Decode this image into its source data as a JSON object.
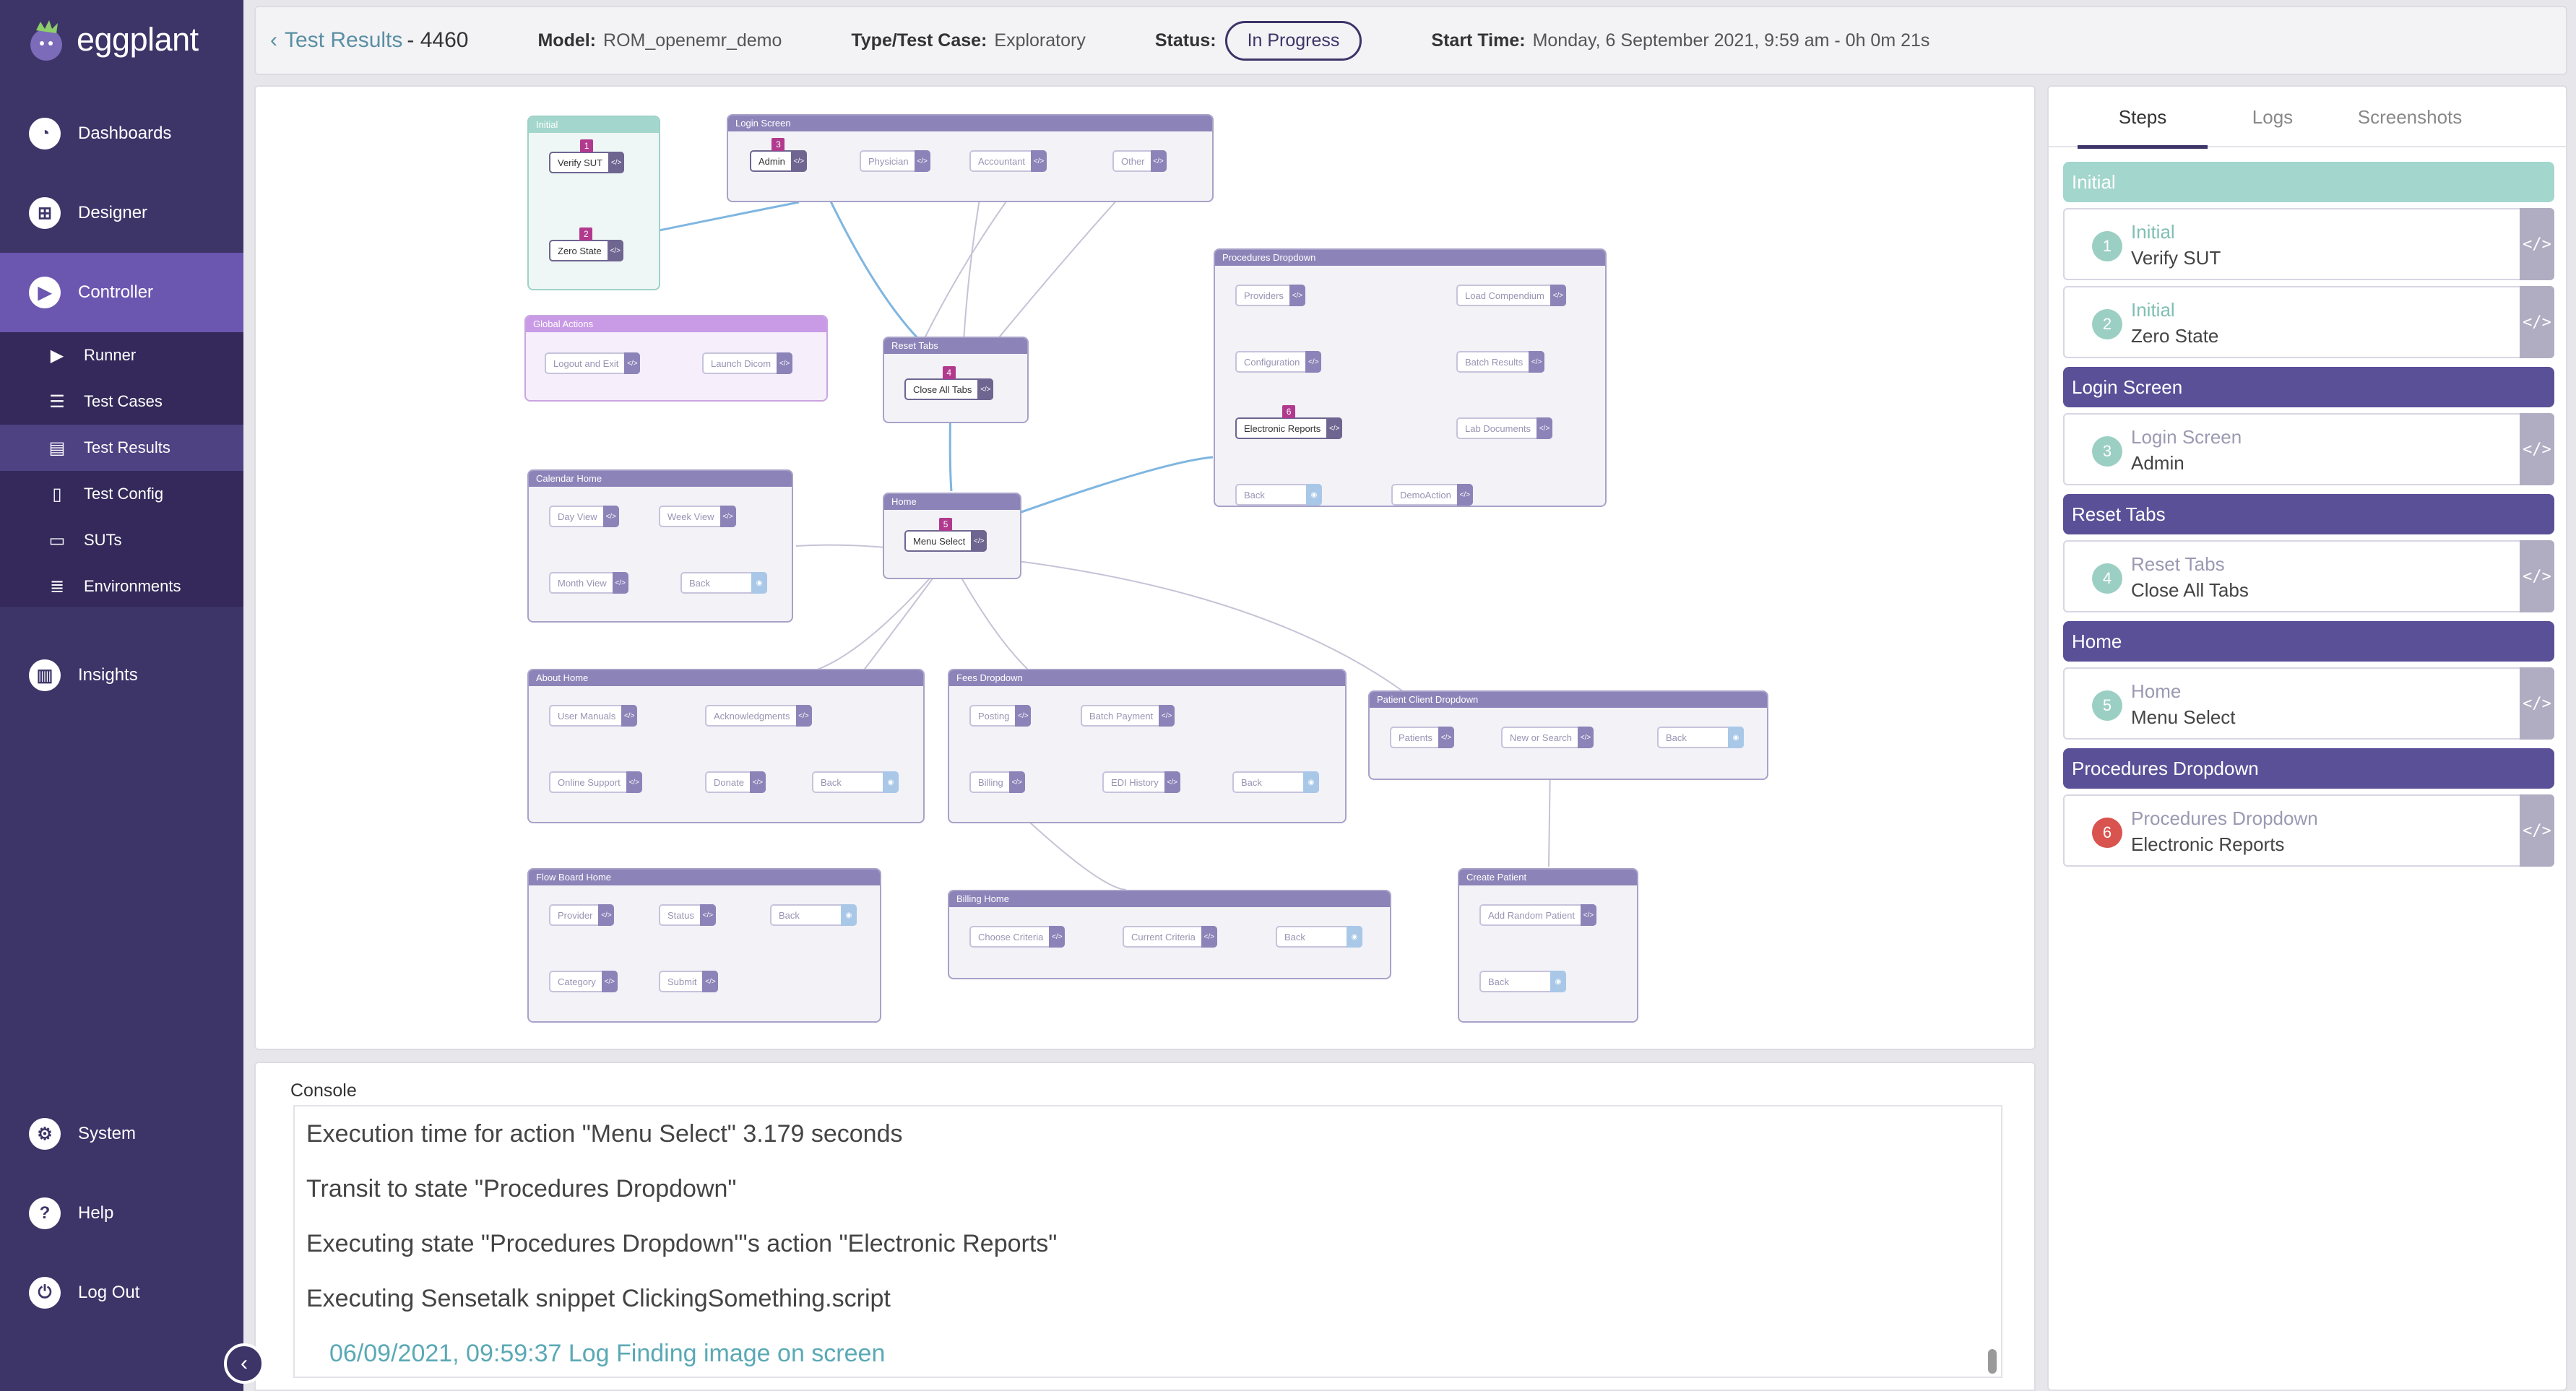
{
  "app": {
    "brand": "eggplant"
  },
  "sidebar": {
    "nav": [
      {
        "label": "Dashboards",
        "icon": "dashboards-icon"
      },
      {
        "label": "Designer",
        "icon": "designer-icon"
      },
      {
        "label": "Controller",
        "icon": "controller-icon"
      },
      {
        "label": "Insights",
        "icon": "insights-icon"
      },
      {
        "label": "System",
        "icon": "system-icon"
      },
      {
        "label": "Help",
        "icon": "help-icon"
      },
      {
        "label": "Log Out",
        "icon": "logout-icon"
      }
    ],
    "sub": [
      {
        "label": "Runner",
        "icon": "play-icon"
      },
      {
        "label": "Test Cases",
        "icon": "list-icon"
      },
      {
        "label": "Test Results",
        "icon": "chart-icon"
      },
      {
        "label": "Test Config",
        "icon": "document-icon"
      },
      {
        "label": "SUTs",
        "icon": "monitor-icon"
      },
      {
        "label": "Environments",
        "icon": "server-icon"
      }
    ],
    "active_nav": "Controller",
    "active_sub": "Test Results"
  },
  "header": {
    "title_link": "Test Results",
    "title_id": "- 4460",
    "model_label": "Model:",
    "model_value": "ROM_openemr_demo",
    "type_label": "Type/Test Case:",
    "type_value": "Exploratory",
    "status_label": "Status:",
    "status_value": "In Progress",
    "start_label": "Start Time:",
    "start_value": "Monday, 6 September 2021, 9:59 am - 0h 0m 21s"
  },
  "flow": {
    "states": {
      "initial": "Initial",
      "login": "Login Screen",
      "global": "Global Actions",
      "reset": "Reset Tabs",
      "procedures": "Procedures Dropdown",
      "calendar": "Calendar Home",
      "home": "Home",
      "about": "About Home",
      "fees": "Fees Dropdown",
      "patient": "Patient Client Dropdown",
      "flowboard": "Flow Board Home",
      "billing": "Billing Home",
      "create": "Create Patient"
    },
    "actions": {
      "verify_sut": "Verify SUT",
      "zero_state": "Zero State",
      "admin": "Admin",
      "physician": "Physician",
      "accountant": "Accountant",
      "other": "Other",
      "logout_exit": "Logout and Exit",
      "launch_dicom": "Launch Dicom",
      "close_all_tabs": "Close All Tabs",
      "providers": "Providers",
      "load_compendium": "Load Compendium",
      "configuration": "Configuration",
      "batch_results": "Batch Results",
      "electronic_reports": "Electronic Reports",
      "lab_documents": "Lab Documents",
      "proc_back": "Back",
      "demo_action": "DemoAction",
      "day_view": "Day View",
      "week_view": "Week View",
      "month_view": "Month View",
      "cal_back": "Back",
      "menu_select": "Menu Select",
      "user_manuals": "User Manuals",
      "acknowledgments": "Acknowledgments",
      "online_support": "Online Support",
      "donate": "Donate",
      "about_back": "Back",
      "posting": "Posting",
      "batch_payment": "Batch Payment",
      "billing_action": "Billing",
      "edi_history": "EDI History",
      "fees_back": "Back",
      "patients": "Patients",
      "new_or_search": "New or Search",
      "patient_back": "Back",
      "provider": "Provider",
      "status": "Status",
      "flow_back": "Back",
      "category": "Category",
      "submit": "Submit",
      "choose_criteria": "Choose Criteria",
      "current_criteria": "Current Criteria",
      "billing_back": "Back",
      "add_random_patient": "Add Random Patient",
      "create_back": "Back"
    },
    "badges": [
      "1",
      "2",
      "3",
      "4",
      "5",
      "6"
    ]
  },
  "console": {
    "title": "Console",
    "lines": [
      "Execution time for action \"Menu Select\" 3.179 seconds",
      "Transit to state \"Procedures Dropdown\"",
      "Executing state \"Procedures Dropdown\"'s action \"Electronic Reports\"",
      "Executing Sensetalk snippet ClickingSomething.script",
      "06/09/2021, 09:59:37 Log Finding image on screen"
    ]
  },
  "right_panel": {
    "tabs": [
      "Steps",
      "Logs",
      "Screenshots"
    ],
    "active_tab": "Steps",
    "groups": [
      {
        "title": "Initial",
        "steps": [
          {
            "num": "1",
            "state": "Initial",
            "action": "Verify SUT",
            "result": "ok"
          },
          {
            "num": "2",
            "state": "Initial",
            "action": "Zero State",
            "result": "ok"
          }
        ]
      },
      {
        "title": "Login Screen",
        "steps": [
          {
            "num": "3",
            "state": "Login Screen",
            "action": "Admin",
            "result": "ok"
          }
        ]
      },
      {
        "title": "Reset Tabs",
        "steps": [
          {
            "num": "4",
            "state": "Reset Tabs",
            "action": "Close All Tabs",
            "result": "ok"
          }
        ]
      },
      {
        "title": "Home",
        "steps": [
          {
            "num": "5",
            "state": "Home",
            "action": "Menu Select",
            "result": "ok"
          }
        ]
      },
      {
        "title": "Procedures Dropdown",
        "steps": [
          {
            "num": "6",
            "state": "Procedures Dropdown",
            "action": "Electronic Reports",
            "result": "fail"
          }
        ]
      }
    ],
    "code_glyph": "</>"
  },
  "colors": {
    "sidebar": "#3d3468",
    "sidebar_active": "#6b56b0",
    "initial_group": "#a3d6cc",
    "group": "#5a5098",
    "step_ok": "#9ccfc3",
    "step_fail": "#d9534f",
    "badge": "#b23a8e"
  }
}
